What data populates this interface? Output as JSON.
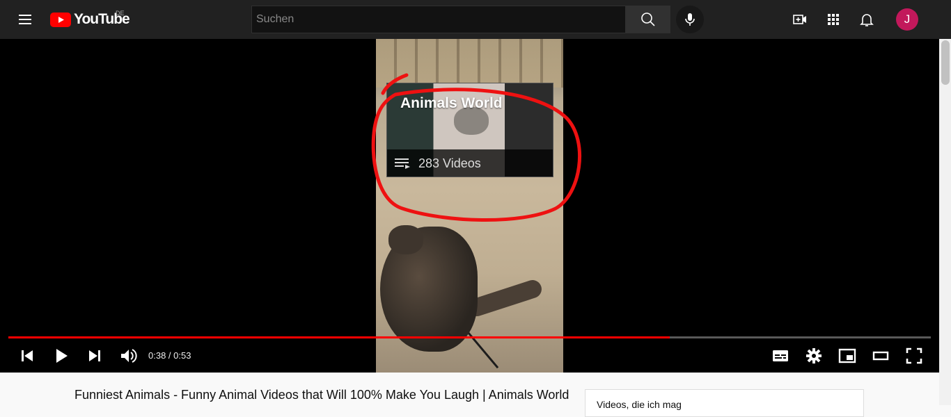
{
  "masthead": {
    "logo_text": "YouTube",
    "country_code": "DE",
    "search_placeholder": "Suchen",
    "avatar_letter": "J",
    "avatar_color": "#c2185b"
  },
  "player": {
    "playlist_card": {
      "title": "Animals World",
      "count": "283 Videos"
    },
    "current_time": "0:38",
    "time_separator": " / ",
    "duration": "0:53",
    "progress": 0.717,
    "progress_color": "#ff0000"
  },
  "page": {
    "video_title": "Funniest Animals - Funny Animal Videos that Will 100% Make You Laugh | Animals World",
    "sidebar_card_label": "Videos, die ich mag"
  },
  "icons": [
    "menu-icon",
    "youtube-logo-icon",
    "search-icon",
    "mic-icon",
    "create-video-icon",
    "apps-icon",
    "bell-icon",
    "playlist-icon",
    "previous-icon",
    "play-icon",
    "next-icon",
    "volume-icon",
    "subtitles-icon",
    "settings-icon",
    "miniplayer-icon",
    "theater-icon",
    "fullscreen-icon"
  ]
}
